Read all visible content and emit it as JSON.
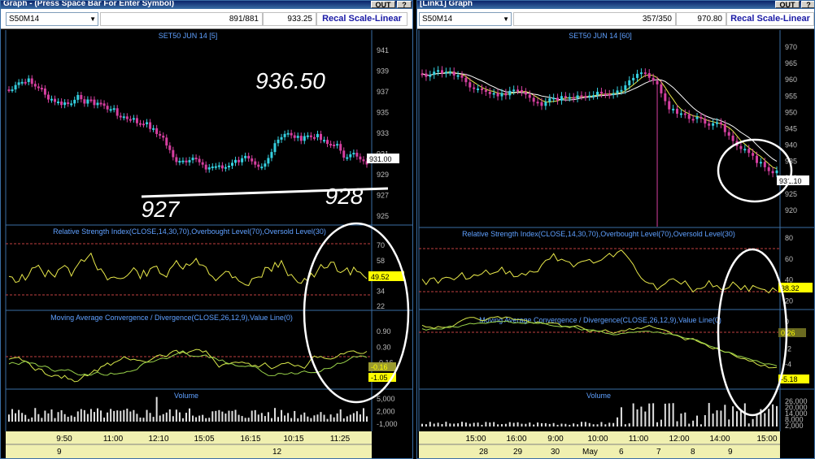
{
  "left": {
    "window_title": "Graph - (Press Space Bar For Enter Symbol)",
    "title_button": "OUT",
    "symbol": "S50M14",
    "count": "891/881",
    "price": "933.25",
    "recal_label": "Recal Scale-Linear",
    "price_panel_title": "SET50 JUN 14   [5]",
    "price_ticks": [
      "941",
      "939",
      "937",
      "935",
      "933",
      "931",
      "929",
      "927",
      "925"
    ],
    "last_price_badge": "931.00",
    "annotations": [
      "936.50",
      "927",
      "928"
    ],
    "rsi_title": "Relative Strength Index(CLOSE,14,30,70),Overbought Level(70),Oversold Level(30)",
    "rsi_ticks": [
      "70",
      "58",
      "46",
      "34",
      "22"
    ],
    "rsi_badge": "49.52",
    "macd_title": "Moving Average Convergence / Divergence(CLOSE,26,12,9),Value Line(0)",
    "macd_ticks": [
      "0.90",
      "0.30",
      "-0.16",
      "-1.05"
    ],
    "macd_badge_1": "-0.16",
    "macd_badge_2": "-1.05",
    "volume_title": "Volume",
    "volume_ticks": [
      "5,000",
      "2,000",
      "-1,000"
    ],
    "time_labels": [
      "9:50",
      "11:00",
      "12:10",
      "15:05",
      "16:15",
      "10:15",
      "11:25"
    ],
    "date_labels": [
      "9",
      "12"
    ]
  },
  "right": {
    "window_title": "[Link1] Graph",
    "title_button": "OUT",
    "symbol": "S50M14",
    "count": "357/350",
    "price": "970.80",
    "recal_label": "Recal Scale-Linear",
    "price_panel_title": "SET50 JUN 14   [60]",
    "price_ticks": [
      "970",
      "965",
      "960",
      "955",
      "950",
      "945",
      "940",
      "935",
      "930",
      "925",
      "920"
    ],
    "last_price_badge": "931.10",
    "rsi_title": "Relative Strength Index(CLOSE,14,30,70),Overbought Level(70),Oversold Level(30)",
    "rsi_ticks": [
      "80",
      "60",
      "40",
      "20",
      "0"
    ],
    "rsi_badge": "38.32",
    "macd_title": "Moving Average Convergence / Divergence(CLOSE,26,12,9),Value Line(0)",
    "macd_ticks": [
      "0.26",
      "-2",
      "-4",
      "-5.18"
    ],
    "macd_badge_1": "0.26",
    "macd_badge_2": "-5.18",
    "volume_title": "Volume",
    "volume_ticks": [
      "26,000",
      "20,000",
      "14,000",
      "8,000",
      "2,000"
    ],
    "time_labels": [
      "15:00",
      "16:00",
      "9:00",
      "10:00",
      "11:00",
      "12:00",
      "14:00",
      "15:00"
    ],
    "date_labels": [
      "28",
      "29",
      "30",
      "May",
      "6",
      "7",
      "8",
      "9"
    ]
  },
  "colors": {
    "up": "#35d0e0",
    "down": "#d63fa0",
    "rsi": "#e8e84a",
    "macd_fast": "#d8e84a",
    "macd_slow": "#9ad44a",
    "badge_yellow": "#ffff00",
    "level": "#c04040",
    "panel_title": "#5fa0ff"
  }
}
